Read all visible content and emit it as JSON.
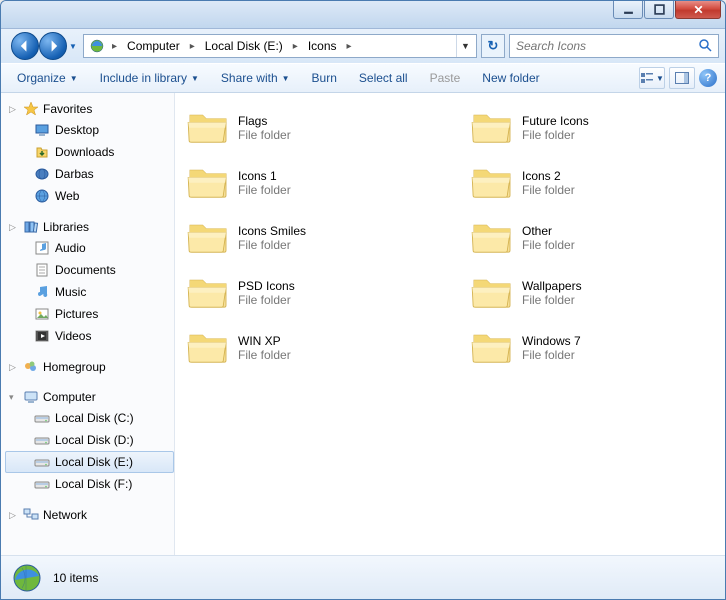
{
  "breadcrumb": {
    "segments": [
      "Computer",
      "Local Disk (E:)",
      "Icons"
    ]
  },
  "search": {
    "placeholder": "Search Icons"
  },
  "toolbar": {
    "organize": "Organize",
    "include": "Include in library",
    "share": "Share with",
    "burn": "Burn",
    "select_all": "Select all",
    "paste": "Paste",
    "new_folder": "New folder"
  },
  "sidebar": {
    "favorites": {
      "label": "Favorites",
      "items": [
        "Desktop",
        "Downloads",
        "Darbas",
        "Web"
      ]
    },
    "libraries": {
      "label": "Libraries",
      "items": [
        "Audio",
        "Documents",
        "Music",
        "Pictures",
        "Videos"
      ]
    },
    "homegroup": {
      "label": "Homegroup"
    },
    "computer": {
      "label": "Computer",
      "items": [
        "Local Disk (C:)",
        "Local Disk (D:)",
        "Local Disk (E:)",
        "Local Disk (F:)"
      ],
      "selected_index": 2
    },
    "network": {
      "label": "Network"
    }
  },
  "content": {
    "type_label": "File folder",
    "items": [
      {
        "name": "Flags"
      },
      {
        "name": "Future Icons"
      },
      {
        "name": "Icons 1"
      },
      {
        "name": "Icons 2"
      },
      {
        "name": "Icons Smiles"
      },
      {
        "name": "Other"
      },
      {
        "name": "PSD Icons"
      },
      {
        "name": "Wallpapers"
      },
      {
        "name": "WIN XP"
      },
      {
        "name": "Windows 7"
      }
    ]
  },
  "status": {
    "text": "10 items"
  }
}
